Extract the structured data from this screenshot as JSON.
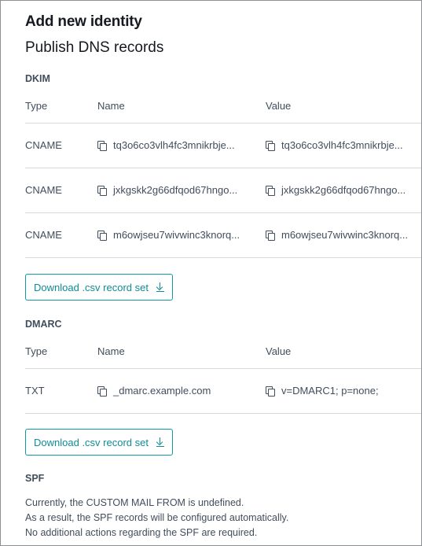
{
  "title": "Add new identity",
  "subtitle": "Publish DNS records",
  "dkim": {
    "label": "DKIM",
    "headers": {
      "type": "Type",
      "name": "Name",
      "value": "Value"
    },
    "rows": [
      {
        "type": "CNAME",
        "name": "tq3o6co3vlh4fc3mnikrbje...",
        "value": "tq3o6co3vlh4fc3mnikrbje..."
      },
      {
        "type": "CNAME",
        "name": "jxkgskk2g66dfqod67hngo...",
        "value": "jxkgskk2g66dfqod67hngo..."
      },
      {
        "type": "CNAME",
        "name": "m6owjseu7wivwinc3knorq...",
        "value": "m6owjseu7wivwinc3knorq..."
      }
    ],
    "download_label": "Download .csv record set"
  },
  "dmarc": {
    "label": "DMARC",
    "headers": {
      "type": "Type",
      "name": "Name",
      "value": "Value"
    },
    "rows": [
      {
        "type": "TXT",
        "name": "_dmarc.example.com",
        "value": "v=DMARC1; p=none;"
      }
    ],
    "download_label": "Download .csv record set"
  },
  "spf": {
    "label": "SPF",
    "lines": [
      "Currently, the CUSTOM MAIL FROM is undefined.",
      "As a result, the SPF records will be configured automatically.",
      "No additional actions regarding the SPF are required."
    ]
  },
  "colors": {
    "accent": "#0f8c95",
    "border": "#d5dbdb",
    "text": "#414d5c"
  }
}
